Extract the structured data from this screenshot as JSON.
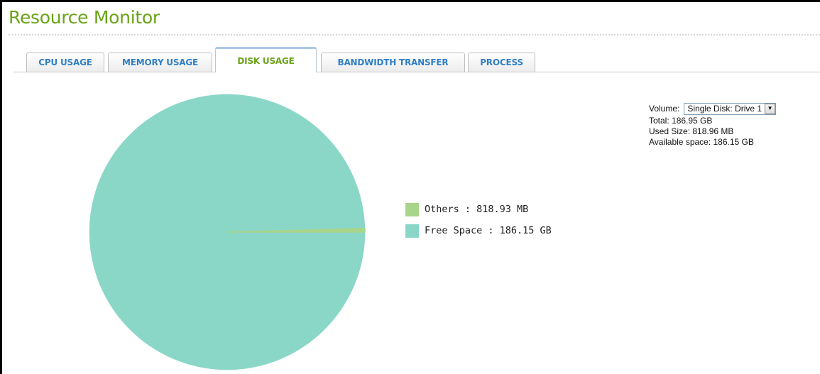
{
  "app": {
    "title": "Resource Monitor"
  },
  "tabs": [
    {
      "label": "CPU USAGE",
      "active": false
    },
    {
      "label": "MEMORY USAGE",
      "active": false
    },
    {
      "label": "DISK USAGE",
      "active": true
    },
    {
      "label": "BANDWIDTH TRANSFER",
      "active": false
    },
    {
      "label": "PROCESS",
      "active": false
    }
  ],
  "volume": {
    "label": "Volume:",
    "selected": "Single Disk: Drive 1",
    "total": "Total: 186.95 GB",
    "used": "Used Size: 818.96 MB",
    "available": "Available space: 186.15 GB"
  },
  "colors": {
    "accent_green": "#6aa318",
    "tab_blue": "#2f7fc6",
    "others": "#a8d58a",
    "free_space": "#8ad7c8"
  },
  "chart_data": {
    "type": "pie",
    "slices": [
      {
        "label": "Others : 818.93 MB",
        "value": 818.93,
        "unit": "MB",
        "color": "#a8d58a"
      },
      {
        "label": "Free Space : 186.15 GB",
        "value": 190617.6,
        "unit": "MB",
        "color": "#8ad7c8"
      }
    ],
    "legend_position": "right"
  }
}
